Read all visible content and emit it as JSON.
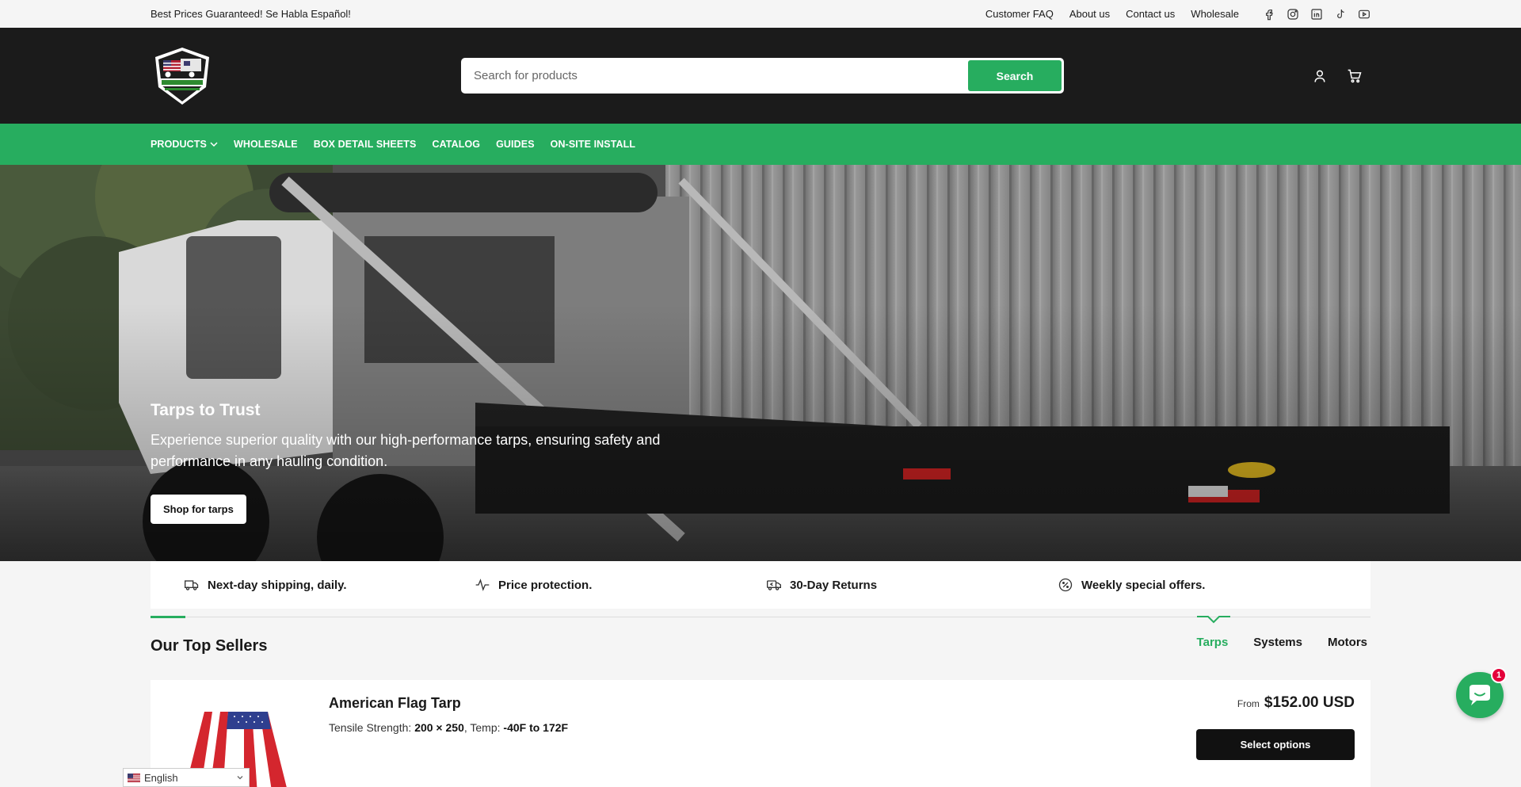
{
  "topbar": {
    "promo": "Best Prices Guaranteed! Se Habla Español!",
    "links": [
      "Customer FAQ",
      "About us",
      "Contact us",
      "Wholesale"
    ],
    "social_icons": [
      "facebook-icon",
      "instagram-icon",
      "linkedin-icon",
      "tiktok-icon",
      "youtube-icon"
    ]
  },
  "header": {
    "search_placeholder": "Search for products",
    "search_button": "Search",
    "icons": [
      "account-icon",
      "cart-icon"
    ]
  },
  "nav": {
    "items": [
      "PRODUCTS",
      "WHOLESALE",
      "BOX DETAIL SHEETS",
      "CATALOG",
      "GUIDES",
      "ON-SITE INSTALL"
    ]
  },
  "hero": {
    "title": "Tarps to Trust",
    "subtitle": "Experience superior quality with our high-performance tarps, ensuring safety and performance in any hauling condition.",
    "button": "Shop for tarps"
  },
  "features": [
    {
      "icon": "truck-icon",
      "label": "Next-day shipping, daily."
    },
    {
      "icon": "pulse-icon",
      "label": "Price protection."
    },
    {
      "icon": "return-truck-icon",
      "label": "30-Day Returns"
    },
    {
      "icon": "percent-icon",
      "label": "Weekly special offers."
    }
  ],
  "sellers": {
    "title": "Our Top Sellers",
    "tabs": [
      "Tarps",
      "Systems",
      "Motors"
    ],
    "active_tab": "Tarps"
  },
  "product": {
    "name": "American Flag Tarp",
    "spec_tensile_label": "Tensile Strength:",
    "spec_tensile_value": "200 × 250",
    "spec_sep": ",",
    "spec_temp_label": "Temp:",
    "spec_temp_value": "-40F to 172F",
    "price_prefix": "From",
    "price": "$152.00 USD",
    "button": "Select options"
  },
  "chat": {
    "badge": "1"
  },
  "language": {
    "selected": "English"
  },
  "colors": {
    "accent": "#27ad5f",
    "header_bg": "#1b1b1b",
    "badge": "#e4003a"
  }
}
